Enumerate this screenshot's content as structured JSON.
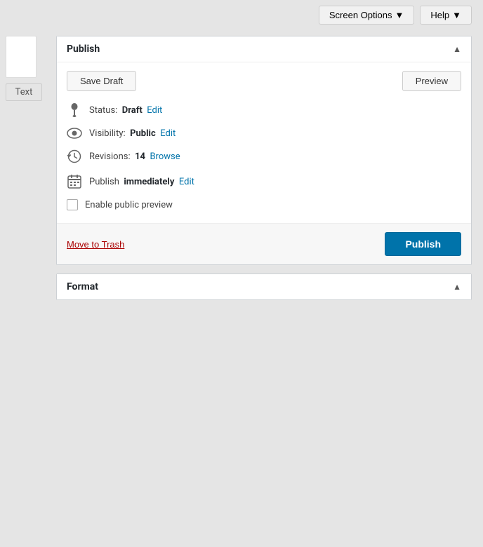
{
  "topbar": {
    "screen_options_label": "Screen Options",
    "screen_options_arrow": "▼",
    "help_label": "Help",
    "help_arrow": "▼"
  },
  "sidebar": {
    "text_label": "Text"
  },
  "publish_panel": {
    "title": "Publish",
    "toggle_icon": "▲",
    "save_draft_label": "Save Draft",
    "preview_label": "Preview",
    "status_label": "Status:",
    "status_value": "Draft",
    "status_edit": "Edit",
    "visibility_label": "Visibility:",
    "visibility_value": "Public",
    "visibility_edit": "Edit",
    "revisions_label": "Revisions:",
    "revisions_value": "14",
    "revisions_browse": "Browse",
    "schedule_label": "Publish",
    "schedule_value": "immediately",
    "schedule_edit": "Edit",
    "checkbox_label": "Enable public preview",
    "trash_label": "Move to Trash",
    "publish_label": "Publish"
  },
  "format_panel": {
    "title": "Format",
    "toggle_icon": "▲"
  },
  "icons": {
    "pin": "📌",
    "eye": "👁",
    "history": "🕐",
    "calendar": "📅"
  }
}
